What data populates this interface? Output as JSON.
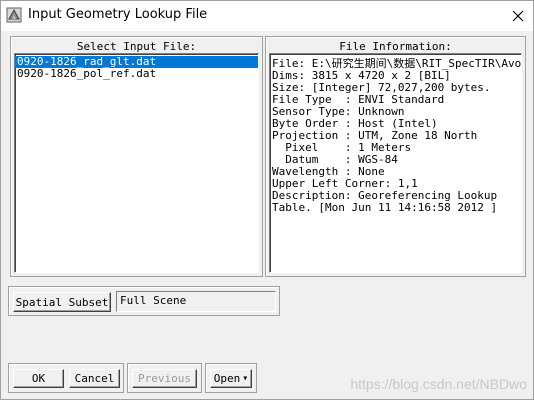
{
  "window": {
    "title": "Input Geometry Lookup File",
    "icon": "envi-app-icon",
    "close_glyph": "✕"
  },
  "select_panel": {
    "title": "Select Input File:",
    "files": [
      {
        "name": "0920-1826_rad_glt.dat",
        "selected": true
      },
      {
        "name": "0920-1826_pol_ref.dat",
        "selected": false
      }
    ]
  },
  "info_panel": {
    "title": "File Information:",
    "lines": [
      "File: E:\\研究生期间\\数据\\RIT_SpecTIR\\Avor",
      "Dims: 3815 x 4720 x 2 [BIL]",
      "Size: [Integer] 72,027,200 bytes.",
      "File Type  : ENVI Standard",
      "Sensor Type: Unknown",
      "Byte Order : Host (Intel)",
      "Projection : UTM, Zone 18 North",
      "  Pixel    : 1 Meters",
      "  Datum    : WGS-84",
      "Wavelength : None",
      "Upper Left Corner: 1,1",
      "Description: Georeferencing Lookup",
      "Table. [Mon Jun 11 14:16:58 2012 ]"
    ]
  },
  "subset": {
    "button_label": "Spatial Subset",
    "value": "Full Scene"
  },
  "buttons": {
    "ok": "OK",
    "cancel": "Cancel",
    "previous": "Previous",
    "open": "Open",
    "open_arrow": "▾"
  },
  "watermark": "https://blog.csdn.net/NBDwo"
}
